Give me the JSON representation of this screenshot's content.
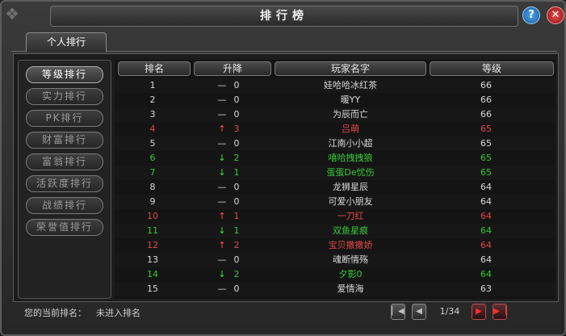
{
  "window": {
    "title": "排行榜"
  },
  "tabs": [
    {
      "label": "个人排行"
    }
  ],
  "sidebar": {
    "items": [
      {
        "label": "等级排行",
        "active": true
      },
      {
        "label": "实力排行",
        "active": false
      },
      {
        "label": "PK排行",
        "active": false
      },
      {
        "label": "财富排行",
        "active": false
      },
      {
        "label": "富翁排行",
        "active": false
      },
      {
        "label": "活跃度排行",
        "active": false
      },
      {
        "label": "战绩排行",
        "active": false
      },
      {
        "label": "荣誉值排行",
        "active": false
      }
    ]
  },
  "table": {
    "headers": {
      "rank": "排名",
      "change": "升降",
      "name": "玩家名字",
      "level": "等级"
    },
    "rows": [
      {
        "rank": "1",
        "trend": "same",
        "arrow": "—",
        "change": "0",
        "name": "娃哈哈冰红茶",
        "level": "66"
      },
      {
        "rank": "2",
        "trend": "same",
        "arrow": "—",
        "change": "0",
        "name": "暖YY",
        "level": "66"
      },
      {
        "rank": "3",
        "trend": "same",
        "arrow": "—",
        "change": "0",
        "name": "为辰而亡",
        "level": "66"
      },
      {
        "rank": "4",
        "trend": "up",
        "arrow": "↑",
        "change": "3",
        "name": "吕萌",
        "level": "65"
      },
      {
        "rank": "5",
        "trend": "same",
        "arrow": "—",
        "change": "0",
        "name": "江南小小超",
        "level": "65"
      },
      {
        "rank": "6",
        "trend": "down",
        "arrow": "↓",
        "change": "2",
        "name": "嘻哈拽拽狼",
        "level": "65"
      },
      {
        "rank": "7",
        "trend": "down",
        "arrow": "↓",
        "change": "1",
        "name": "蛋蛋De忧伤",
        "level": "65"
      },
      {
        "rank": "8",
        "trend": "same",
        "arrow": "—",
        "change": "0",
        "name": "龙狮星辰",
        "level": "64"
      },
      {
        "rank": "9",
        "trend": "same",
        "arrow": "—",
        "change": "0",
        "name": "可爱小朋友",
        "level": "64"
      },
      {
        "rank": "10",
        "trend": "up",
        "arrow": "↑",
        "change": "1",
        "name": "一刀红",
        "level": "64"
      },
      {
        "rank": "11",
        "trend": "down",
        "arrow": "↓",
        "change": "1",
        "name": "双鱼星痕",
        "level": "64"
      },
      {
        "rank": "12",
        "trend": "up",
        "arrow": "↑",
        "change": "2",
        "name": "宝贝撒撒娇",
        "level": "64"
      },
      {
        "rank": "13",
        "trend": "same",
        "arrow": "—",
        "change": "0",
        "name": "魂断情殇",
        "level": "64"
      },
      {
        "rank": "14",
        "trend": "down",
        "arrow": "↓",
        "change": "2",
        "name": "夕影0",
        "level": "64"
      },
      {
        "rank": "15",
        "trend": "same",
        "arrow": "—",
        "change": "0",
        "name": "爱情海",
        "level": "63"
      }
    ]
  },
  "footer": {
    "current_rank_label": "您的当前排名：",
    "current_rank_value": "未进入排名"
  },
  "pager": {
    "page_text": "1/34",
    "first_icon": "first-page-icon",
    "prev_icon": "prev-page-icon",
    "next_icon": "next-page-icon",
    "last_icon": "last-page-icon"
  },
  "colors": {
    "up": "#e04848",
    "down": "#36c936",
    "same": "#d8d8d8"
  }
}
